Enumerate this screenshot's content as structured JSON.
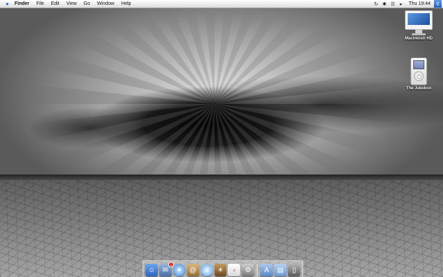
{
  "menubar": {
    "apple_icon": "apple-icon",
    "app_name": "Finder",
    "items": [
      "File",
      "Edit",
      "View",
      "Go",
      "Window",
      "Help"
    ],
    "status_icons": [
      "sync-icon",
      "bluetooth-icon",
      "wifi-icon",
      "volume-icon"
    ],
    "clock": "Thu 19:44",
    "spotlight_icon": "spotlight-icon"
  },
  "desktop": {
    "icons": [
      {
        "label": "Macintosh HD",
        "icon": "hard-drive-icon"
      },
      {
        "label": "The Jukebox",
        "icon": "ipod-icon"
      }
    ]
  },
  "dock": {
    "items": [
      {
        "icon": "finder-icon",
        "color": "#3f7fd6"
      },
      {
        "icon": "mail-icon",
        "color": "#5a7fb8",
        "badge": "1"
      },
      {
        "icon": "safari-icon",
        "color": "#4a90d9"
      },
      {
        "icon": "address-book-icon",
        "color": "#b08a4a"
      },
      {
        "icon": "itunes-icon",
        "color": "#5aa0e0"
      },
      {
        "icon": "iphoto-icon",
        "color": "#8a6a3a"
      },
      {
        "icon": "ical-icon",
        "color": "#e8e8e8"
      },
      {
        "icon": "system-preferences-icon",
        "color": "#9a9a9a"
      },
      {
        "icon": "applications-folder-icon",
        "color": "#6a9ad0"
      },
      {
        "icon": "documents-folder-icon",
        "color": "#7aa6d8"
      },
      {
        "icon": "trash-icon",
        "color": "#7a7a7a"
      }
    ],
    "mail_badge": "1"
  }
}
